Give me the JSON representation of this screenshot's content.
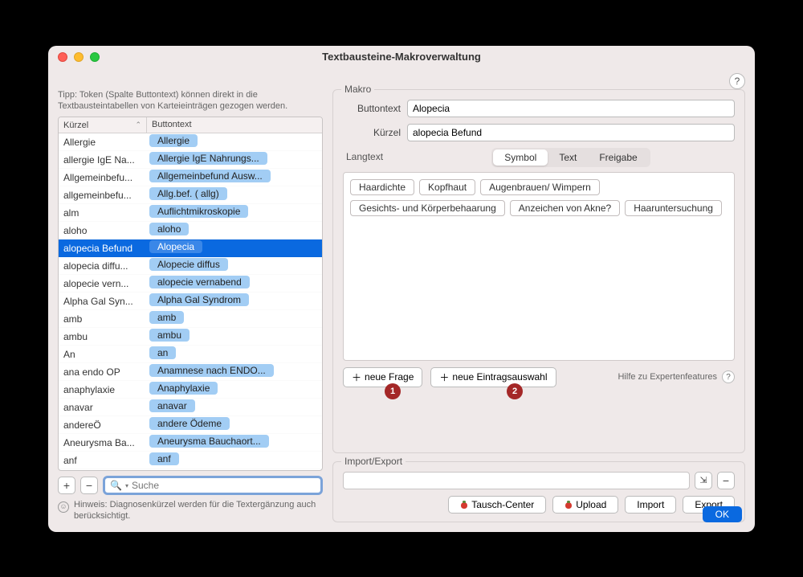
{
  "window": {
    "title": "Textbausteine-Makroverwaltung"
  },
  "left": {
    "tip": "Tipp: Token (Spalte Buttontext) können direkt in die Textbausteintabellen von Karteieinträgen gezogen werden.",
    "columns": {
      "kuerzel": "Kürzel",
      "buttontext": "Buttontext"
    },
    "rows": [
      {
        "k": "Allergie",
        "b": "Allergie"
      },
      {
        "k": "allergie IgE Na...",
        "b": "Allergie IgE Nahrungs..."
      },
      {
        "k": "Allgemeinbefu...",
        "b": "Allgemeinbefund Ausw..."
      },
      {
        "k": "allgemeinbefu...",
        "b": "Allg.bef. ( allg)"
      },
      {
        "k": "alm",
        "b": "Auflichtmikroskopie"
      },
      {
        "k": "aloho",
        "b": "aloho"
      },
      {
        "k": "alopecia Befund",
        "b": "Alopecia",
        "selected": true
      },
      {
        "k": "alopecia diffu...",
        "b": "Alopecie diffus"
      },
      {
        "k": "alopecie vern...",
        "b": "alopecie vernabend"
      },
      {
        "k": "Alpha Gal Syn...",
        "b": "Alpha Gal Syndrom"
      },
      {
        "k": "amb",
        "b": "amb"
      },
      {
        "k": "ambu",
        "b": "ambu"
      },
      {
        "k": "An",
        "b": "an"
      },
      {
        "k": "ana endo OP",
        "b": "Anamnese nach ENDO..."
      },
      {
        "k": "anaphylaxie",
        "b": "Anaphylaxie"
      },
      {
        "k": "anavar",
        "b": "anavar"
      },
      {
        "k": "andereÖ",
        "b": "andere Ödeme"
      },
      {
        "k": "Aneurysma Ba...",
        "b": "Aneurysma Bauchaort..."
      },
      {
        "k": "anf",
        "b": "anf"
      }
    ],
    "search_placeholder": "Suche",
    "hint": "Hinweis: Diagnosenkürzel werden für die Textergänzung auch berücksichtigt."
  },
  "makro": {
    "label": "Makro",
    "buttontext_label": "Buttontext",
    "buttontext_value": "Alopecia",
    "kuerzel_label": "Kürzel",
    "kuerzel_value": "alopecia Befund",
    "langtext_label": "Langtext",
    "tabs": {
      "symbol": "Symbol",
      "text": "Text",
      "freigabe": "Freigabe"
    },
    "chips": [
      "Haardichte",
      "Kopfhaut",
      "Augenbrauen/ Wimpern",
      "Gesichts- und Körperbehaarung",
      "Anzeichen von Akne?",
      "Haaruntersuchung"
    ],
    "neue_frage": "neue Frage",
    "neue_eintragsauswahl": "neue Eintragsauswahl",
    "expert_help": "Hilfe zu Expertenfeatures",
    "bubble1": "1",
    "bubble2": "2"
  },
  "import_export": {
    "label": "Import/Export",
    "tausch": "Tausch-Center",
    "upload": "Upload",
    "import": "Import",
    "export": "Export"
  },
  "ok": "OK"
}
